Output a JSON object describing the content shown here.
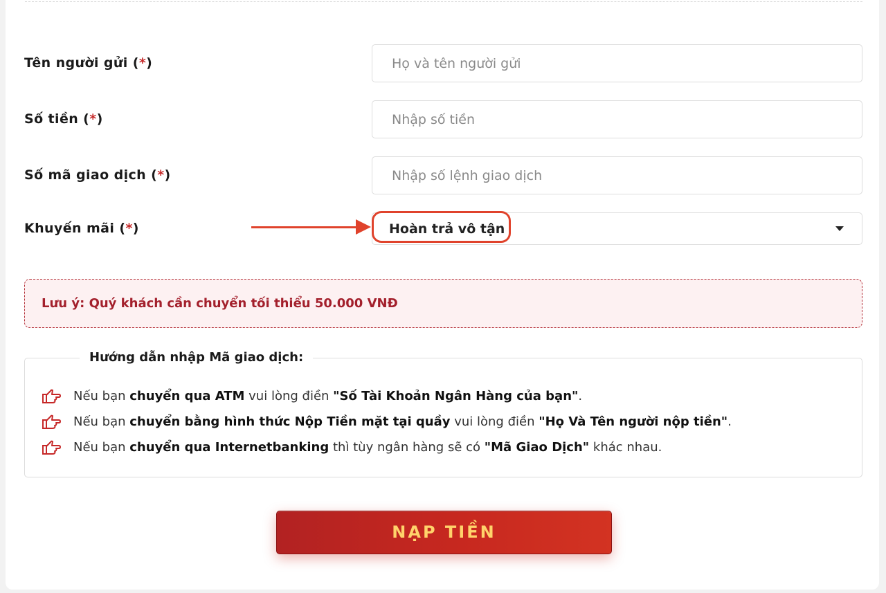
{
  "form": {
    "sender_name": {
      "label": "Tên người gửi",
      "required_mark": "*",
      "placeholder": "Họ và tên người gửi"
    },
    "amount": {
      "label": "Số tiền",
      "required_mark": "*",
      "placeholder": "Nhập số tiền"
    },
    "transaction_code": {
      "label": "Số mã giao dịch",
      "required_mark": "*",
      "placeholder": "Nhập số lệnh giao dịch"
    },
    "promotion": {
      "label": "Khuyến mãi",
      "required_mark": "*",
      "selected": "Hoàn trả vô tận"
    }
  },
  "note": {
    "text": "Lưu ý: Quý khách cần chuyển tối thiểu 50.000 VNĐ"
  },
  "guide": {
    "title": "Hướng dẫn nhập Mã giao dịch:",
    "items": [
      {
        "p1": "Nếu bạn ",
        "b1": "chuyển qua ATM",
        "p2": " vui lòng điền ",
        "b2": "\"Số Tài Khoản Ngân Hàng của bạn\"",
        "p3": "."
      },
      {
        "p1": "Nếu bạn ",
        "b1": "chuyển bằng hình thức Nộp Tiền mặt tại quầy",
        "p2": " vui lòng điền ",
        "b2": "\"Họ Và Tên người nộp tiền\"",
        "p3": "."
      },
      {
        "p1": "Nếu bạn ",
        "b1": "chuyển qua Internetbanking",
        "p2": " thì tùy ngân hàng sẽ có ",
        "b2": "\"Mã Giao Dịch\"",
        "p3": " khác nhau."
      }
    ]
  },
  "submit_button": {
    "label": "NẠP TIỀN"
  },
  "colors": {
    "accent": "#e0432c",
    "required": "#c62828",
    "note_text": "#a3202c",
    "button": "#c7281f",
    "button_text": "#ffd36b"
  },
  "icons": {
    "guide_bullet": "pointing-hand-icon",
    "select_caret": "caret-down-icon",
    "annotation": "arrow-right-icon"
  }
}
